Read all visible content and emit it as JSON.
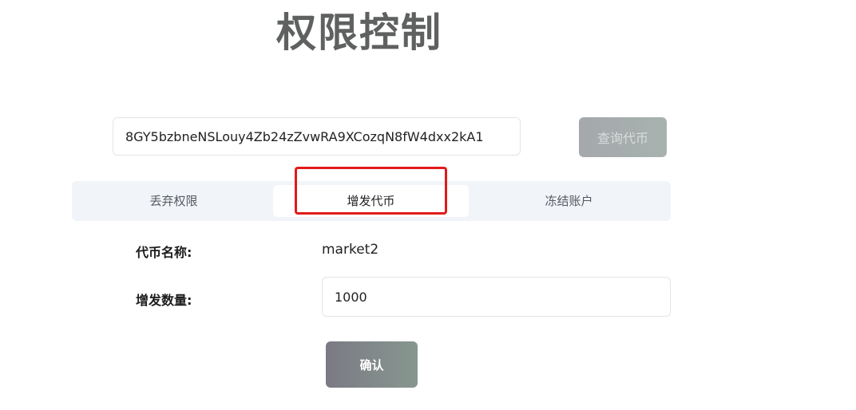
{
  "page": {
    "title": "权限控制"
  },
  "search": {
    "address_value": "8GY5bzbneNSLouy4Zb24zZvwRA9XCozqN8fW4dxx2kA1",
    "query_button_label": "查询代币"
  },
  "tabs": [
    {
      "label": "丢弃权限",
      "active": false
    },
    {
      "label": "增发代币",
      "active": true
    },
    {
      "label": "冻结账户",
      "active": false
    }
  ],
  "form": {
    "token_name_label": "代币名称:",
    "token_name_value": "market2",
    "mint_amount_label": "增发数量:",
    "mint_amount_value": "1000",
    "confirm_button_label": "确认"
  },
  "colors": {
    "highlight_box": "#e11a1a",
    "tab_bar_bg": "#f1f4f8",
    "title_text": "#5f6160"
  }
}
